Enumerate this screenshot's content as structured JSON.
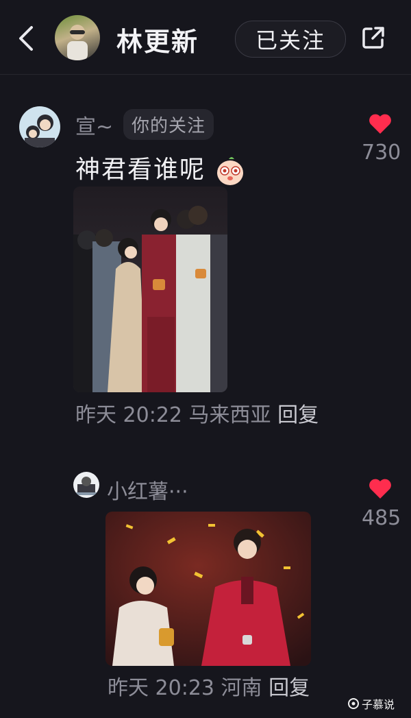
{
  "header": {
    "title": "林更新",
    "follow_label": "已关注",
    "back_icon": "back-icon",
    "share_icon": "share-icon"
  },
  "comments": [
    {
      "user": "宣~",
      "tag": "你的关注",
      "text": "神君看谁呢",
      "time": "昨天 20:22",
      "location": "马来西亚",
      "reply": "回复",
      "likes": "730"
    },
    {
      "user": "小红薯···",
      "time": "昨天 20:23",
      "location": "河南",
      "reply": "回复",
      "likes": "485"
    }
  ],
  "watermark": "子慕说",
  "colors": {
    "heart": "#ff2d4e",
    "background": "#16161d"
  }
}
